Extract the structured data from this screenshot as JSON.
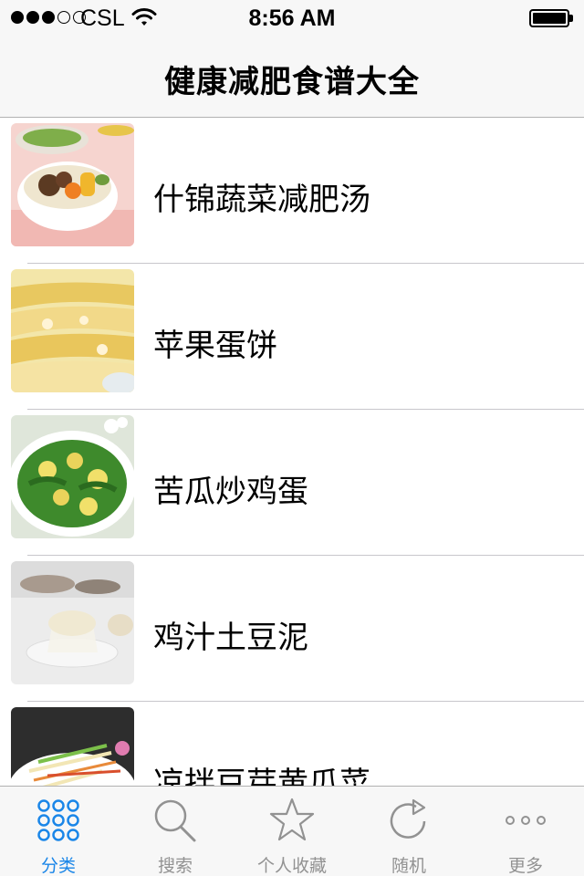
{
  "status_bar": {
    "carrier": "CSL",
    "time": "8:56 AM",
    "signal_bars_filled": 3,
    "signal_bars_total": 5
  },
  "nav": {
    "title": "健康减肥食谱大全"
  },
  "recipes": [
    {
      "name": "什锦蔬菜减肥汤",
      "thumb_icon": "vegetable-soup-photo"
    },
    {
      "name": "苹果蛋饼",
      "thumb_icon": "apple-egg-pancake-photo"
    },
    {
      "name": "苦瓜炒鸡蛋",
      "thumb_icon": "bitter-melon-egg-photo"
    },
    {
      "name": "鸡汁土豆泥",
      "thumb_icon": "mashed-potato-photo"
    },
    {
      "name": "凉拌豆芽黄瓜菜",
      "thumb_icon": "bean-sprout-salad-photo"
    }
  ],
  "tabbar": {
    "tabs": [
      {
        "label": "分类",
        "icon": "grid-dots-icon",
        "active": true
      },
      {
        "label": "搜索",
        "icon": "search-icon",
        "active": false
      },
      {
        "label": "个人收藏",
        "icon": "star-icon",
        "active": false
      },
      {
        "label": "随机",
        "icon": "refresh-icon",
        "active": false
      },
      {
        "label": "更多",
        "icon": "more-dots-icon",
        "active": false
      }
    ]
  },
  "colors": {
    "accent": "#1a86e8",
    "inactive": "#929292",
    "bar_bg": "#f7f7f7"
  }
}
